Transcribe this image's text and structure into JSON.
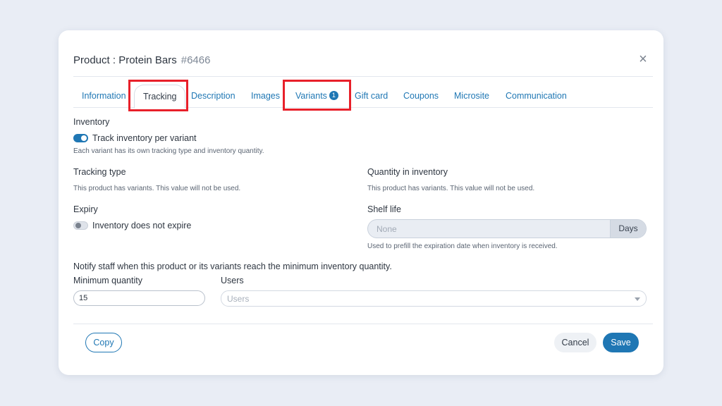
{
  "modal": {
    "title": "Product : Protein Bars",
    "id": "#6466",
    "close_glyph": "×"
  },
  "tabs": [
    {
      "label": "Information"
    },
    {
      "label": "Tracking"
    },
    {
      "label": "Description"
    },
    {
      "label": "Images"
    },
    {
      "label": "Variants",
      "badge": "1"
    },
    {
      "label": "Gift card"
    },
    {
      "label": "Coupons"
    },
    {
      "label": "Microsite"
    },
    {
      "label": "Communication"
    }
  ],
  "inventory": {
    "heading": "Inventory",
    "toggle_label": "Track inventory per variant",
    "toggle_on": true,
    "help": "Each variant has its own tracking type and inventory quantity."
  },
  "tracking_type": {
    "label": "Tracking type",
    "help": "This product has variants. This value will not be used."
  },
  "quantity_in_inventory": {
    "label": "Quantity in inventory",
    "help": "This product has variants. This value will not be used."
  },
  "expiry": {
    "label": "Expiry",
    "toggle_label": "Inventory does not expire",
    "toggle_on": false
  },
  "shelf_life": {
    "label": "Shelf life",
    "placeholder": "None",
    "unit": "Days",
    "help": "Used to prefill the expiration date when inventory is received."
  },
  "notify": {
    "text": "Notify staff when this product or its variants reach the minimum inventory quantity.",
    "min_label": "Minimum quantity",
    "min_value": "15",
    "users_label": "Users",
    "users_placeholder": "Users"
  },
  "footer": {
    "copy": "Copy",
    "cancel": "Cancel",
    "save": "Save"
  },
  "colors": {
    "accent": "#1f77b4",
    "highlight": "#e8202a",
    "background": "#e9edf5"
  }
}
